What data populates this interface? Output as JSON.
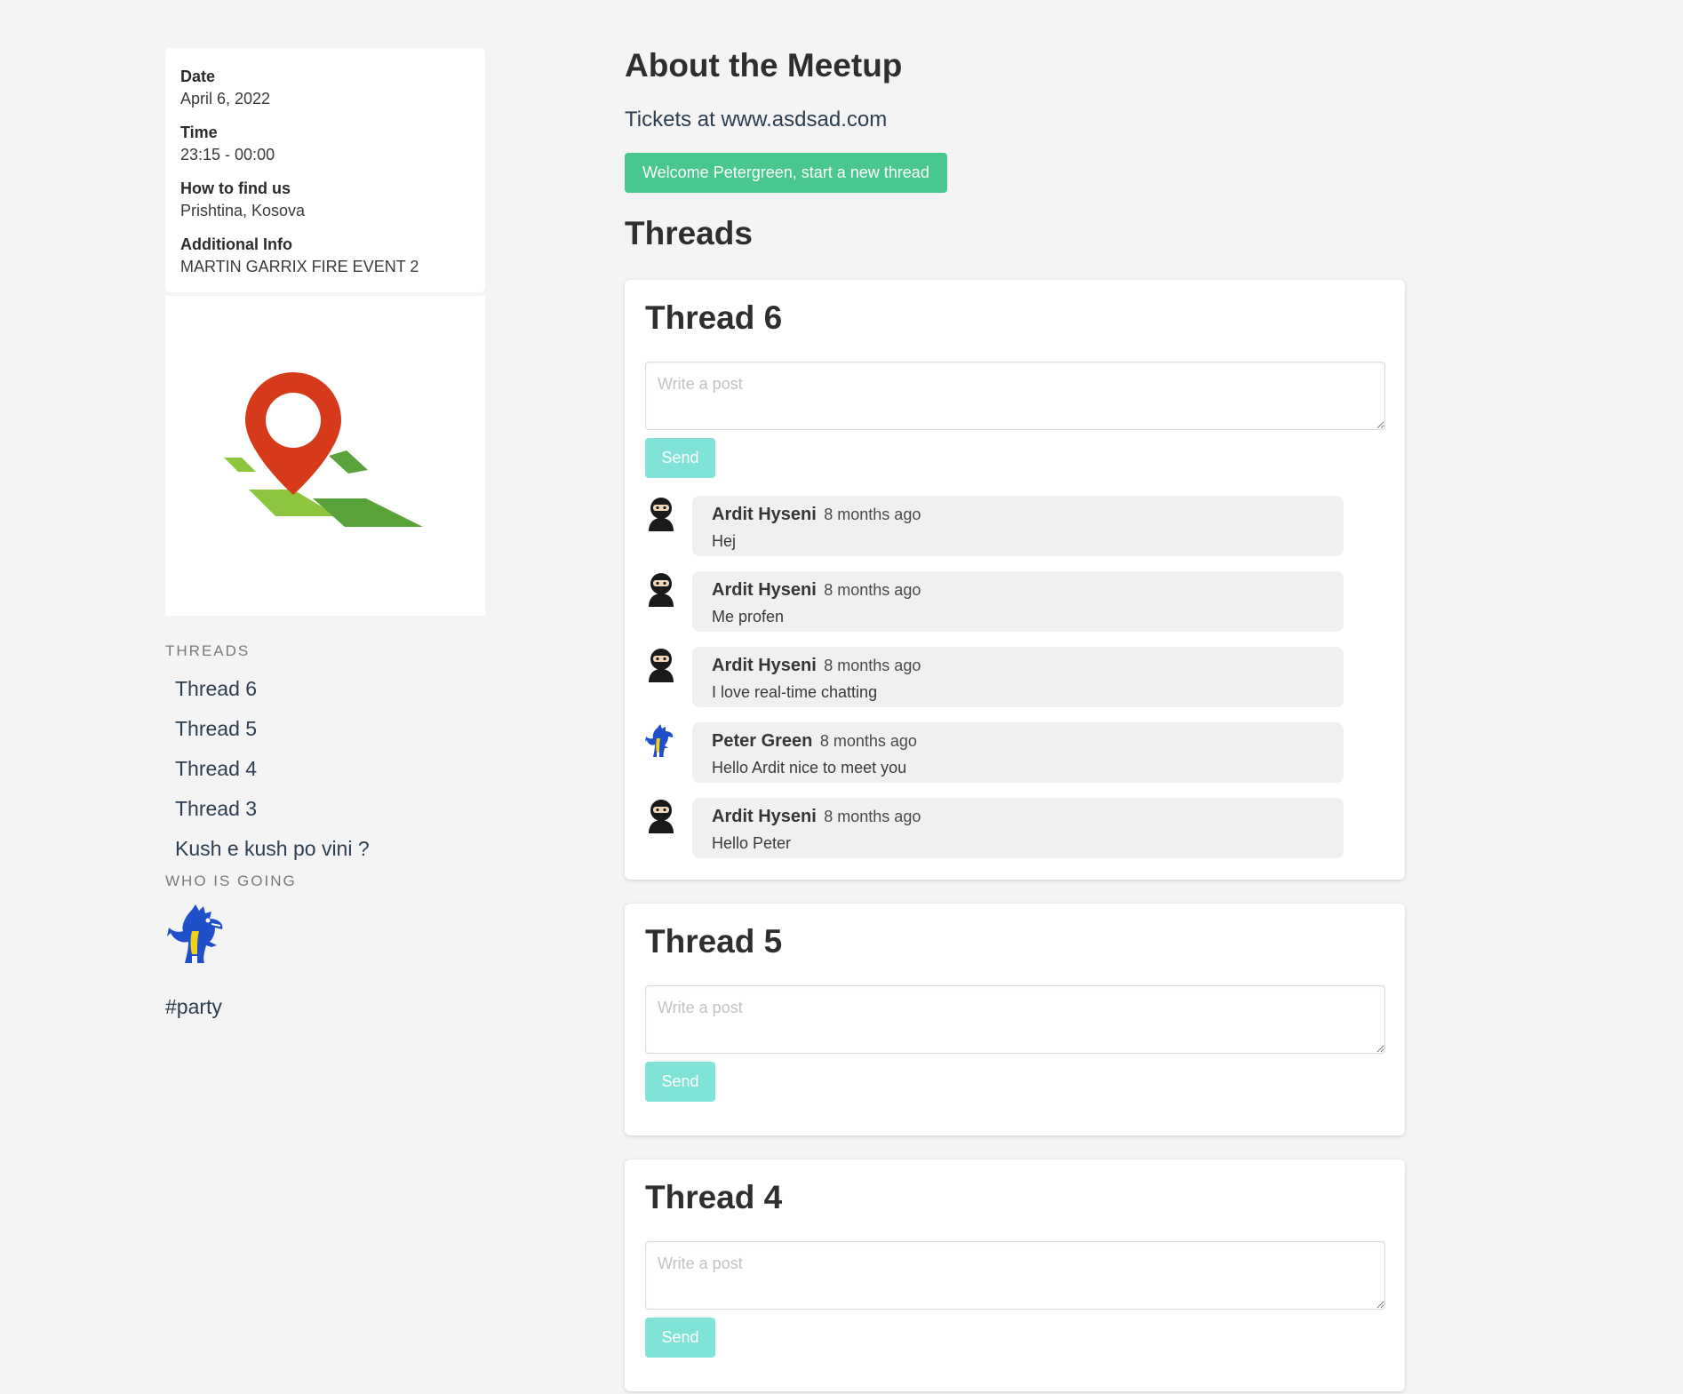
{
  "event_info": {
    "date_label": "Date",
    "date_value": "April 6, 2022",
    "time_label": "Time",
    "time_value": "23:15 - 00:00",
    "location_label": "How to find us",
    "location_value": "Prishtina, Kosova",
    "additional_label": "Additional Info",
    "additional_value": "MARTIN GARRIX FIRE EVENT 2"
  },
  "sidebar": {
    "threads_title": "THREADS",
    "thread_links": [
      "Thread 6",
      "Thread 5",
      "Thread 4",
      "Thread 3",
      "Kush e kush po vini ?"
    ],
    "who_title": "WHO IS GOING",
    "tag": "#party"
  },
  "main": {
    "title": "About the Meetup",
    "tickets": "Tickets at www.asdsad.com",
    "new_thread_button": "Welcome Petergreen, start a new thread",
    "threads_heading": "Threads"
  },
  "threads": [
    {
      "title": "Thread 6",
      "placeholder": "Write a post",
      "send_label": "Send",
      "messages": [
        {
          "author": "Ardit Hyseni",
          "time": "8 months ago",
          "text": "Hej",
          "avatar": "ninja-avatar"
        },
        {
          "author": "Ardit Hyseni",
          "time": "8 months ago",
          "text": "Me profen",
          "avatar": "ninja-avatar"
        },
        {
          "author": "Ardit Hyseni",
          "time": "8 months ago",
          "text": "I love real-time chatting",
          "avatar": "ninja-avatar"
        },
        {
          "author": "Peter Green",
          "time": "8 months ago",
          "text": "Hello Ardit nice to meet you",
          "avatar": "dragon-avatar"
        },
        {
          "author": "Ardit Hyseni",
          "time": "8 months ago",
          "text": "Hello Peter",
          "avatar": "ninja-avatar"
        }
      ]
    },
    {
      "title": "Thread 5",
      "placeholder": "Write a post",
      "send_label": "Send"
    },
    {
      "title": "Thread 4",
      "placeholder": "Write a post",
      "send_label": "Send"
    }
  ],
  "colors": {
    "primary_button": "#48c78e",
    "send_button": "#7fe3d8",
    "map_pin": "#d63a1a",
    "map_green": "#6bb33f",
    "background": "#f4f4f4"
  }
}
